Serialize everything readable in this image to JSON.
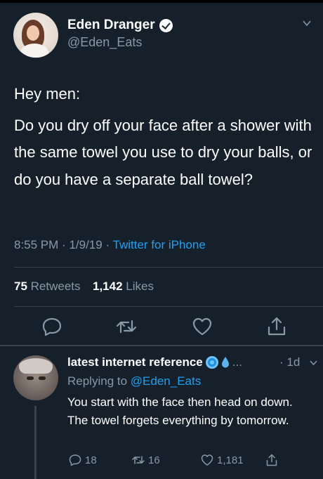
{
  "tweet": {
    "author_name": "Eden Dranger",
    "author_handle": "@Eden_Eats",
    "body_lines": [
      "Hey men:",
      "Do you dry off your face after a shower with the same towel you use to dry your balls, or do you have a separate ball towel?"
    ],
    "time": "8:55 PM",
    "date": "1/9/19",
    "source": "Twitter for iPhone",
    "retweets_count": "75",
    "retweets_label": "Retweets",
    "likes_count": "1,142",
    "likes_label": "Likes"
  },
  "reply": {
    "author_name": "latest internet reference",
    "ellipsis": "...",
    "time": "1d",
    "replying_prefix": "Replying to",
    "replying_handle": "@Eden_Eats",
    "body": "You start with the face then head on down. The towel forgets everything by tomorrow.",
    "reply_count": "18",
    "retweet_count": "16",
    "like_count": "1,181"
  },
  "icons": {
    "verified": "verified-badge-icon",
    "chevron": "chevron-down-icon",
    "reply": "reply-icon",
    "retweet": "retweet-icon",
    "like": "heart-icon",
    "share": "share-icon",
    "cyclone_emoji": "cyclone-emoji-icon",
    "droplet_emoji": "droplet-emoji-icon"
  },
  "colors": {
    "background": "#15202b",
    "secondary_text": "#8899a6",
    "link": "#1da1f2",
    "divider": "#38444d"
  }
}
